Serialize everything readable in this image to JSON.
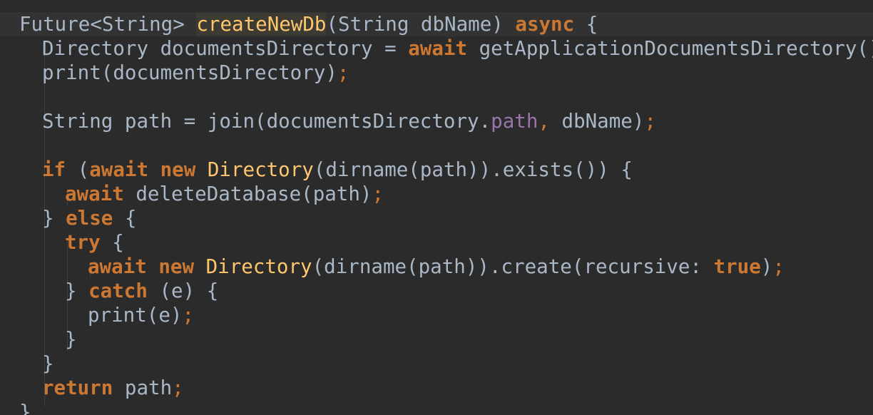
{
  "editor": {
    "theme": "darcula",
    "colors": {
      "background": "#2b2b2b",
      "text": "#a9b7c6",
      "keyword": "#cc7832",
      "function": "#ffc66d",
      "property": "#9876aa"
    },
    "tokens": {
      "future_type": "Future<String> ",
      "fn_name": "createNewDb",
      "fn_params": "(String dbName) ",
      "async": "async",
      "open_brace": " {",
      "dir_decl": "Directory documentsDirectory = ",
      "await": "await",
      "get_docs_dir": " getApplicationDocumentsDirectory()",
      "semi": ";",
      "print_docs": "print(documentsDirectory)",
      "path_decl_a": "String path = join(documentsDirectory.",
      "path_prop": "path",
      "comma": ",",
      "path_decl_b": " dbName)",
      "if": "if",
      "if_open": " (",
      "new": "new",
      "directory_cls": "Directory",
      "exists_call": "(dirname(path)).exists()) {",
      "delete_call": " deleteDatabase(path)",
      "close_brace_pre": "} ",
      "else": "else",
      "try": "try",
      "create_call_a": "(dirname(path)).create(recursive: ",
      "true": "true",
      "create_call_b": ")",
      "catch": "catch",
      "catch_rest": " (e) {",
      "print_e": "print(e)",
      "close_brace": "}",
      "return": "return",
      "return_rest": " path",
      "space": " "
    }
  }
}
